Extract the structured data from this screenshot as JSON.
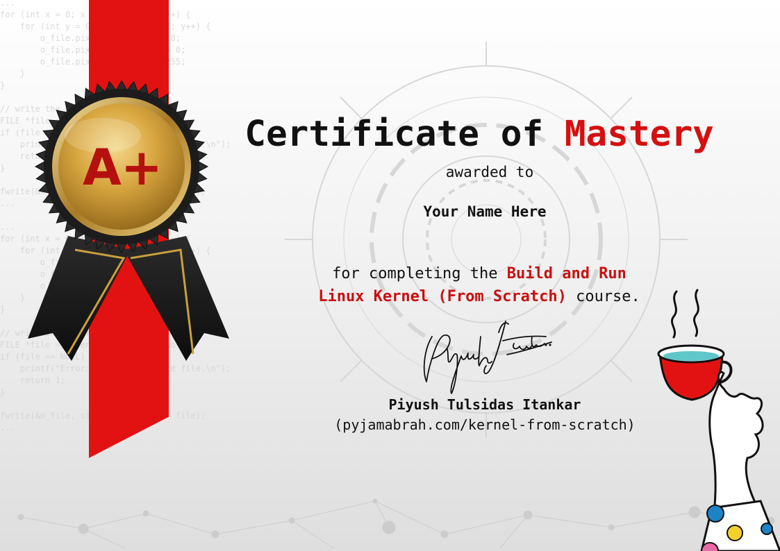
{
  "certificate": {
    "title_main": "Certificate of",
    "title_accent": "Mastery",
    "awarded": "awarded to",
    "recipient": "Your Name Here",
    "completion_prefix": "for completing the",
    "course_line1": "Build and Run",
    "course_line2": "Linux Kernel (From Scratch)",
    "completion_suffix": "course.",
    "signer": "Piyush Tulsidas Itankar",
    "website": "(pyjamabrah.com/kernel-from-scratch)"
  },
  "badge": {
    "grade": "A+",
    "icon": "rosette-medal-icon"
  },
  "signature": {
    "text": "Piyush Itankar",
    "icon": "handwritten-signature-icon"
  },
  "decoration": {
    "mug_icon": "coffee-mug-hand-icon",
    "background_code": "...\nfor (int x = 0; x < IMAGE_SIZE; x++) {\n    for (int y = 0; y < IMAGE_SIZE; y++) {\n        o_file.pixel[x][y].blue = 0;\n        o_file.pixel[x][y].green = 0;\n        o_file.pixel[x][y].red = 255;\n    }\n}\n\n// write the BMP file\nFILE *file = fopen(\"image.bmp\", \"wb\");\nif (file == NULL) {\n    printf(\"Error: Could not create file.\\n\");\n    return 1;\n}\n\nfwrite(&o_file, sizeof(o_file), 1, file);\n...\n\n...\nfor (int x = 0; x < IMAGE_SIZE; x++) {\n    for (int y = 0; y < IMAGE_SIZE; y++) {\n        o_file.pixel[x][y].blue = 0;\n        o_file.pixel[x][y].green = 0;\n        o_file.pixel[x][y].red = 255;\n    }\n}\n\n// write the BMP file\nFILE *file = fopen(\"image.bmp\", \"wb\");\nif (file == NULL) {\n    printf(\"Error: Could not create file.\\n\");\n    return 1;\n}\n\nfwrite(&o_file, sizeof(o_file), 1, file);\n...",
    "colors": {
      "accent_red": "#d41010",
      "ribbon_red": "#e31212",
      "medal_gold": "#d8a640",
      "medal_black": "#1a1a1a"
    }
  }
}
